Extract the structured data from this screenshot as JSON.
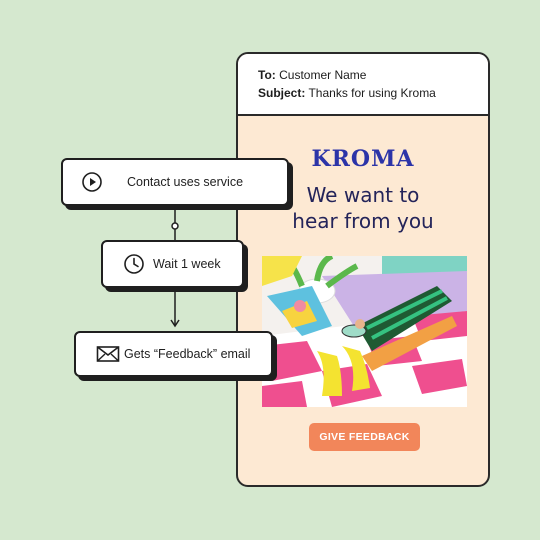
{
  "email": {
    "to_label": "To:",
    "to_value": "Customer Name",
    "subject_label": "Subject:",
    "subject_value": "Thanks for using Kroma",
    "brand": "KROMA",
    "headline_line1": "We want to",
    "headline_line2": "hear from you",
    "cta_label": "GIVE FEEDBACK"
  },
  "workflow": {
    "steps": [
      {
        "label": "Contact uses service",
        "icon": "play-icon"
      },
      {
        "label": "Wait 1 week",
        "icon": "clock-icon"
      },
      {
        "label": "Gets “Feedback” email",
        "icon": "envelope-icon"
      }
    ]
  },
  "colors": {
    "background": "#d5e8cf",
    "email_body": "#fde9d3",
    "brand": "#2c34a8",
    "cta": "#f2865a"
  }
}
